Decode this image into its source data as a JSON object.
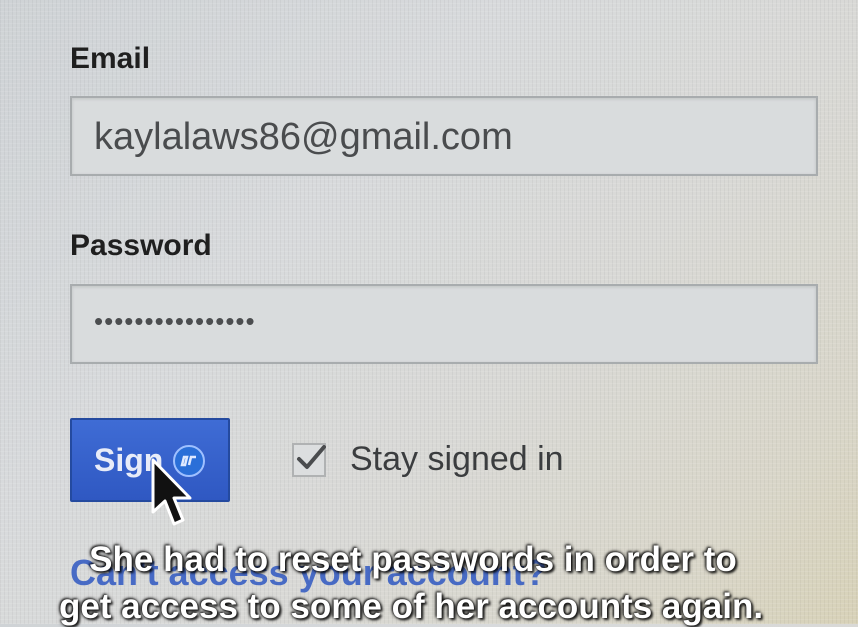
{
  "form": {
    "email_label": "Email",
    "email_value": "kaylalaws86@gmail.com",
    "password_label": "Password",
    "password_value": "••••••••••••••••",
    "signin_label": "Sign",
    "stay_signed_in_label": "Stay signed in",
    "stay_signed_in_checked": true,
    "account_link": "Can't access your account?"
  },
  "subtitles": {
    "line1": "She had to reset passwords in order to",
    "line2": "get access to some of her accounts again."
  },
  "colors": {
    "button": "#2f58c2",
    "link": "#2f58c2"
  },
  "icons": {
    "loading": "loading-spinner-icon",
    "cursor": "mouse-pointer-icon",
    "check": "checkmark-icon"
  }
}
